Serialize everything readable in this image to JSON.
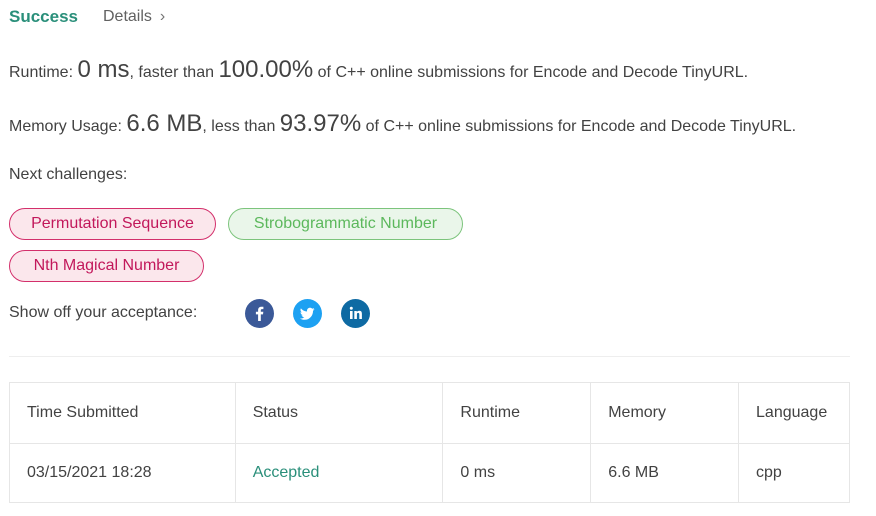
{
  "header": {
    "success": "Success",
    "details": "Details"
  },
  "runtime": {
    "label": "Runtime:",
    "value": "0 ms",
    "text1": ", faster than",
    "percent": "100.00%",
    "text2": "of C++ online submissions for Encode and Decode TinyURL."
  },
  "memory": {
    "label": "Memory Usage:",
    "value": "6.6 MB",
    "text1": ", less than",
    "percent": "93.97%",
    "text2": "of C++ online submissions for Encode and Decode TinyURL."
  },
  "next_challenges": {
    "label": "Next challenges:",
    "items": [
      {
        "label": "Permutation Sequence",
        "difficulty": "hard"
      },
      {
        "label": "Strobogrammatic Number",
        "difficulty": "easy"
      },
      {
        "label": "Nth Magical Number",
        "difficulty": "hard"
      }
    ]
  },
  "share": {
    "label": "Show off your acceptance:",
    "icons": [
      "facebook-icon",
      "twitter-icon",
      "linkedin-icon"
    ]
  },
  "table": {
    "headers": [
      "Time Submitted",
      "Status",
      "Runtime",
      "Memory",
      "Language"
    ],
    "row": [
      "03/15/2021 18:28",
      "Accepted",
      "0 ms",
      "6.6 MB",
      "cpp"
    ]
  },
  "colors": {
    "accent_green": "#2a8f7a",
    "hard_text": "#c2185b",
    "easy_text": "#5cb85c",
    "facebook": "#3b5998",
    "twitter": "#1da1f2",
    "linkedin": "#0e6aa3"
  }
}
